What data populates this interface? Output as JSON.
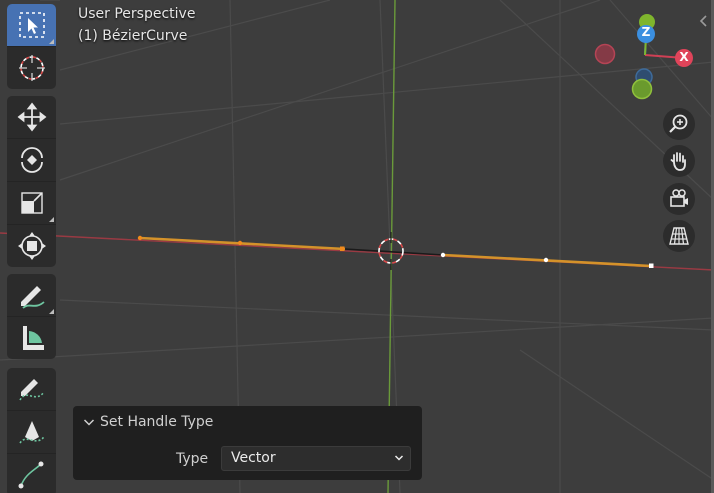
{
  "viewport": {
    "view_name": "User Perspective",
    "object_name": "(1) BézierCurve"
  },
  "toolbar": {
    "tools": [
      {
        "name": "select-box",
        "active": true
      },
      {
        "name": "cursor",
        "active": false
      },
      {
        "name": "move",
        "active": false
      },
      {
        "name": "rotate",
        "active": false
      },
      {
        "name": "scale",
        "active": false
      },
      {
        "name": "transform",
        "active": false
      },
      {
        "name": "annotate",
        "active": false
      },
      {
        "name": "measure",
        "active": false
      },
      {
        "name": "draw",
        "active": false
      },
      {
        "name": "pen",
        "active": false
      },
      {
        "name": "curve-tilt",
        "active": false
      }
    ]
  },
  "gizmo": {
    "z_label": "Z",
    "x_label": "X"
  },
  "nav_buttons": [
    "zoom-icon",
    "hand-pan-icon",
    "camera-icon",
    "grid-perspective-icon"
  ],
  "colors": {
    "x_axis": "#e0445a",
    "y_axis": "#7fb52d",
    "z_axis": "#3b8fe0",
    "curve": "#d4922a",
    "active_tool": "#4772b3"
  },
  "operator_panel": {
    "title": "Set Handle Type",
    "type_label": "Type",
    "type_value": "Vector"
  }
}
